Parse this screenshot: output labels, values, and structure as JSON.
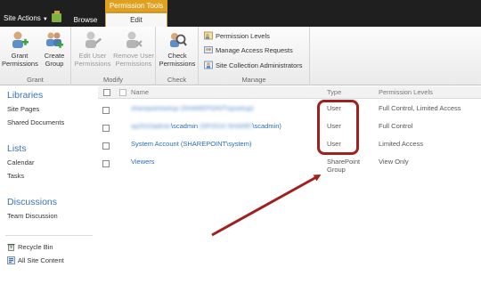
{
  "topbar": {
    "site_actions": "Site Actions",
    "tab_browse": "Browse",
    "context_header": "Permission Tools",
    "tab_edit": "Edit"
  },
  "ribbon": {
    "groups": {
      "grant": {
        "label": "Grant",
        "grant_permissions": "Grant\nPermissions",
        "create_group": "Create\nGroup"
      },
      "modify": {
        "label": "Modify",
        "edit_user_permissions": "Edit User\nPermissions",
        "remove_user_permissions": "Remove User\nPermissions"
      },
      "check": {
        "label": "Check",
        "check_permissions": "Check\nPermissions"
      },
      "manage": {
        "label": "Manage",
        "permission_levels": "Permission Levels",
        "manage_access_requests": "Manage Access Requests",
        "site_collection_admins": "Site Collection Administrators"
      }
    }
  },
  "leftnav": {
    "libraries": {
      "heading": "Libraries",
      "items": [
        "Site Pages",
        "Shared Documents"
      ]
    },
    "lists": {
      "heading": "Lists",
      "items": [
        "Calendar",
        "Tasks"
      ]
    },
    "discussions": {
      "heading": "Discussions",
      "items": [
        "Team Discussion"
      ]
    },
    "bottom": {
      "recycle_bin": "Recycle Bin",
      "all_site_content": "All Site Content"
    }
  },
  "list": {
    "columns": {
      "name": "Name",
      "type": "Type",
      "permission_levels": "Permission Levels"
    },
    "rows": [
      {
        "name": "sharepointsetup (SHAREPOINT\\spsetup)",
        "type": "User",
        "permissions": "Full Control, Limited Access"
      },
      {
        "name_prefix": "sp2010admin",
        "name_suffix": "\\scadmin",
        "name_mid": "(SP2010 SHARE\\",
        "name_end": "\\scadmin)",
        "type": "User",
        "permissions": "Full Control"
      },
      {
        "name": "System Account (SHAREPOINT\\system)",
        "type": "User",
        "permissions": "Limited Access"
      },
      {
        "name": "Viewers",
        "type": "SharePoint\nGroup",
        "permissions": "View Only"
      }
    ]
  },
  "colors": {
    "context_tab": "#e0a020",
    "annotation": "#a01f1f",
    "link": "#2a6bb8",
    "nav_heading": "#3b73b9"
  }
}
